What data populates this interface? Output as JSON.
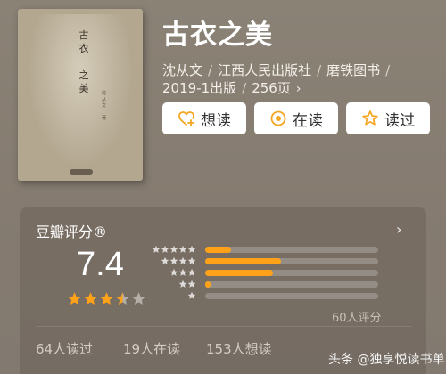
{
  "book": {
    "title": "古衣之美",
    "cover": {
      "title_chars": [
        "古",
        "衣",
        "",
        "之",
        "美"
      ],
      "author_chars": [
        "沈",
        "从",
        "文",
        "",
        "著"
      ]
    },
    "meta": {
      "author": "沈从文",
      "publisher": "江西人民出版社",
      "brand": "磨铁图书",
      "edition": "2019-1出版",
      "pages": "256页"
    }
  },
  "actions": {
    "want": "想读",
    "reading": "在读",
    "read": "读过"
  },
  "rating": {
    "title": "豆瓣评分®",
    "score": "7.4",
    "stars_value": 3.5,
    "distribution": [
      {
        "stars": 5,
        "fraction": 0.15
      },
      {
        "stars": 4,
        "fraction": 0.44
      },
      {
        "stars": 3,
        "fraction": 0.39
      },
      {
        "stars": 2,
        "fraction": 0.03
      },
      {
        "stars": 1,
        "fraction": 0.0
      }
    ],
    "count": "60人评分"
  },
  "stats": {
    "read": "64人读过",
    "reading": "19人在读",
    "want": "153人想读"
  },
  "watermark": "头条 @独享悦读书单",
  "colors": {
    "accent": "#ffa21a",
    "button_icon": "#f5a623"
  }
}
